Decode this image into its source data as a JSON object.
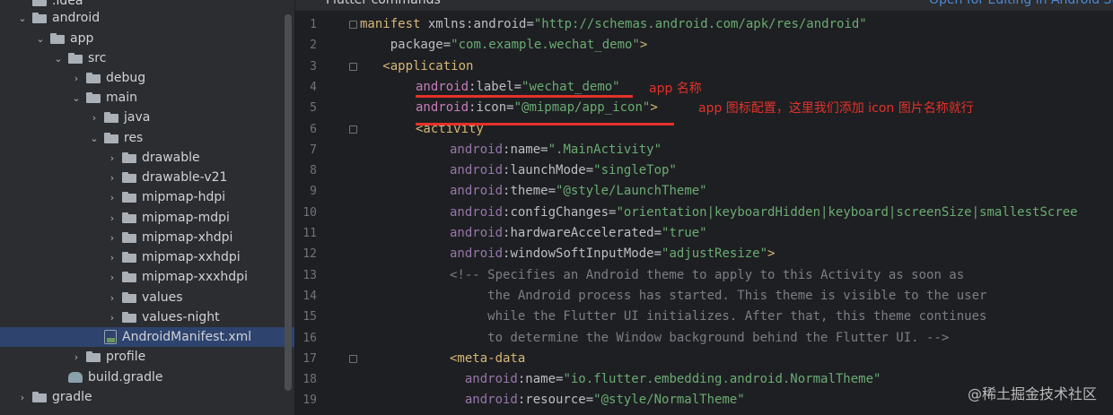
{
  "editor": {
    "head_left": "Flutter commands",
    "head_right": "Open for Editing in Android St",
    "lines": [
      {
        "n": "1",
        "parts": [
          [
            "tag",
            "manifest"
          ],
          [
            "attr",
            " xmlns:android="
          ],
          [
            "str",
            "\"http://schemas.android.com/apk/res/android\""
          ]
        ]
      },
      {
        "n": "2",
        "parts": [
          [
            "attr",
            "    package="
          ],
          [
            "str",
            "\"com.example.wechat_demo\""
          ],
          [
            "tag",
            ">"
          ]
        ]
      },
      {
        "n": "3",
        "parts": [
          [
            "tag",
            "   <application"
          ]
        ]
      },
      {
        "n": "4",
        "parts": [
          [
            "ns",
            "android"
          ],
          [
            "attr",
            ":label="
          ],
          [
            "str",
            "\"wechat_demo\""
          ]
        ]
      },
      {
        "n": "5",
        "parts": [
          [
            "ns",
            "android"
          ],
          [
            "attr",
            ":icon="
          ],
          [
            "str",
            "\"@mipmap/app_icon\""
          ],
          [
            "tag",
            ">"
          ]
        ]
      },
      {
        "n": "6",
        "parts": [
          [
            "tag",
            "<activity"
          ]
        ]
      },
      {
        "n": "7",
        "parts": [
          [
            "ns",
            "android"
          ],
          [
            "attr",
            ":name="
          ],
          [
            "str",
            "\".MainActivity\""
          ]
        ]
      },
      {
        "n": "8",
        "parts": [
          [
            "ns",
            "android"
          ],
          [
            "attr",
            ":launchMode="
          ],
          [
            "str",
            "\"singleTop\""
          ]
        ]
      },
      {
        "n": "9",
        "parts": [
          [
            "ns",
            "android"
          ],
          [
            "attr",
            ":theme="
          ],
          [
            "str",
            "\"@style/LaunchTheme\""
          ]
        ]
      },
      {
        "n": "10",
        "parts": [
          [
            "ns",
            "android"
          ],
          [
            "attr",
            ":configChanges="
          ],
          [
            "str",
            "\"orientation|keyboardHidden|keyboard|screenSize|smallestScree"
          ]
        ]
      },
      {
        "n": "11",
        "parts": [
          [
            "ns",
            "android"
          ],
          [
            "attr",
            ":hardwareAccelerated="
          ],
          [
            "str",
            "\"true\""
          ]
        ]
      },
      {
        "n": "12",
        "parts": [
          [
            "ns",
            "android"
          ],
          [
            "attr",
            ":windowSoftInputMode="
          ],
          [
            "str",
            "\"adjustResize\""
          ],
          [
            "tag",
            ">"
          ]
        ]
      },
      {
        "n": "13",
        "parts": [
          [
            "cmt",
            "<!-- Specifies an Android theme to apply to this Activity as soon as"
          ]
        ]
      },
      {
        "n": "14",
        "parts": [
          [
            "cmt",
            "     the Android process has started. This theme is visible to the user"
          ]
        ]
      },
      {
        "n": "15",
        "parts": [
          [
            "cmt",
            "     while the Flutter UI initializes. After that, this theme continues"
          ]
        ]
      },
      {
        "n": "16",
        "parts": [
          [
            "cmt",
            "     to determine the Window background behind the Flutter UI. -->"
          ]
        ]
      },
      {
        "n": "17",
        "parts": [
          [
            "tag",
            "<meta-data"
          ]
        ]
      },
      {
        "n": "18",
        "parts": [
          [
            "ns",
            "  android"
          ],
          [
            "attr",
            ":name="
          ],
          [
            "str",
            "\"io.flutter.embedding.android.NormalTheme\""
          ]
        ]
      },
      {
        "n": "19",
        "parts": [
          [
            "ns",
            "  android"
          ],
          [
            "attr",
            ":resource="
          ],
          [
            "str",
            "\"@style/NormalTheme\""
          ]
        ]
      }
    ]
  },
  "annotations": {
    "label_note": "app 名称",
    "icon_note": "app 图标配置，这里我们添加 icon 图片名称就行"
  },
  "tree": {
    "items": [
      {
        "label": ".idea",
        "chev": "none",
        "icon": "folder"
      },
      {
        "label": "android",
        "chev": "down",
        "icon": "folder"
      },
      {
        "label": "app",
        "chev": "down",
        "icon": "folder"
      },
      {
        "label": "src",
        "chev": "down",
        "icon": "folder"
      },
      {
        "label": "debug",
        "chev": "right",
        "icon": "folder"
      },
      {
        "label": "main",
        "chev": "down",
        "icon": "folder"
      },
      {
        "label": "java",
        "chev": "right",
        "icon": "folder"
      },
      {
        "label": "res",
        "chev": "down",
        "icon": "folder"
      },
      {
        "label": "drawable",
        "chev": "right",
        "icon": "folder"
      },
      {
        "label": "drawable-v21",
        "chev": "right",
        "icon": "folder"
      },
      {
        "label": "mipmap-hdpi",
        "chev": "right",
        "icon": "folder"
      },
      {
        "label": "mipmap-mdpi",
        "chev": "right",
        "icon": "folder"
      },
      {
        "label": "mipmap-xhdpi",
        "chev": "right",
        "icon": "folder"
      },
      {
        "label": "mipmap-xxhdpi",
        "chev": "right",
        "icon": "folder"
      },
      {
        "label": "mipmap-xxxhdpi",
        "chev": "right",
        "icon": "folder"
      },
      {
        "label": "values",
        "chev": "right",
        "icon": "folder"
      },
      {
        "label": "values-night",
        "chev": "right",
        "icon": "folder"
      },
      {
        "label": "AndroidManifest.xml",
        "chev": "none",
        "icon": "xml"
      },
      {
        "label": "profile",
        "chev": "right",
        "icon": "folder"
      },
      {
        "label": "build.gradle",
        "chev": "none",
        "icon": "gradle"
      },
      {
        "label": "gradle",
        "chev": "right",
        "icon": "folder"
      }
    ]
  },
  "watermark": "@稀土掘金技术社区",
  "colors": {
    "accent_red": "#e4312b",
    "selection": "#2e436e"
  }
}
